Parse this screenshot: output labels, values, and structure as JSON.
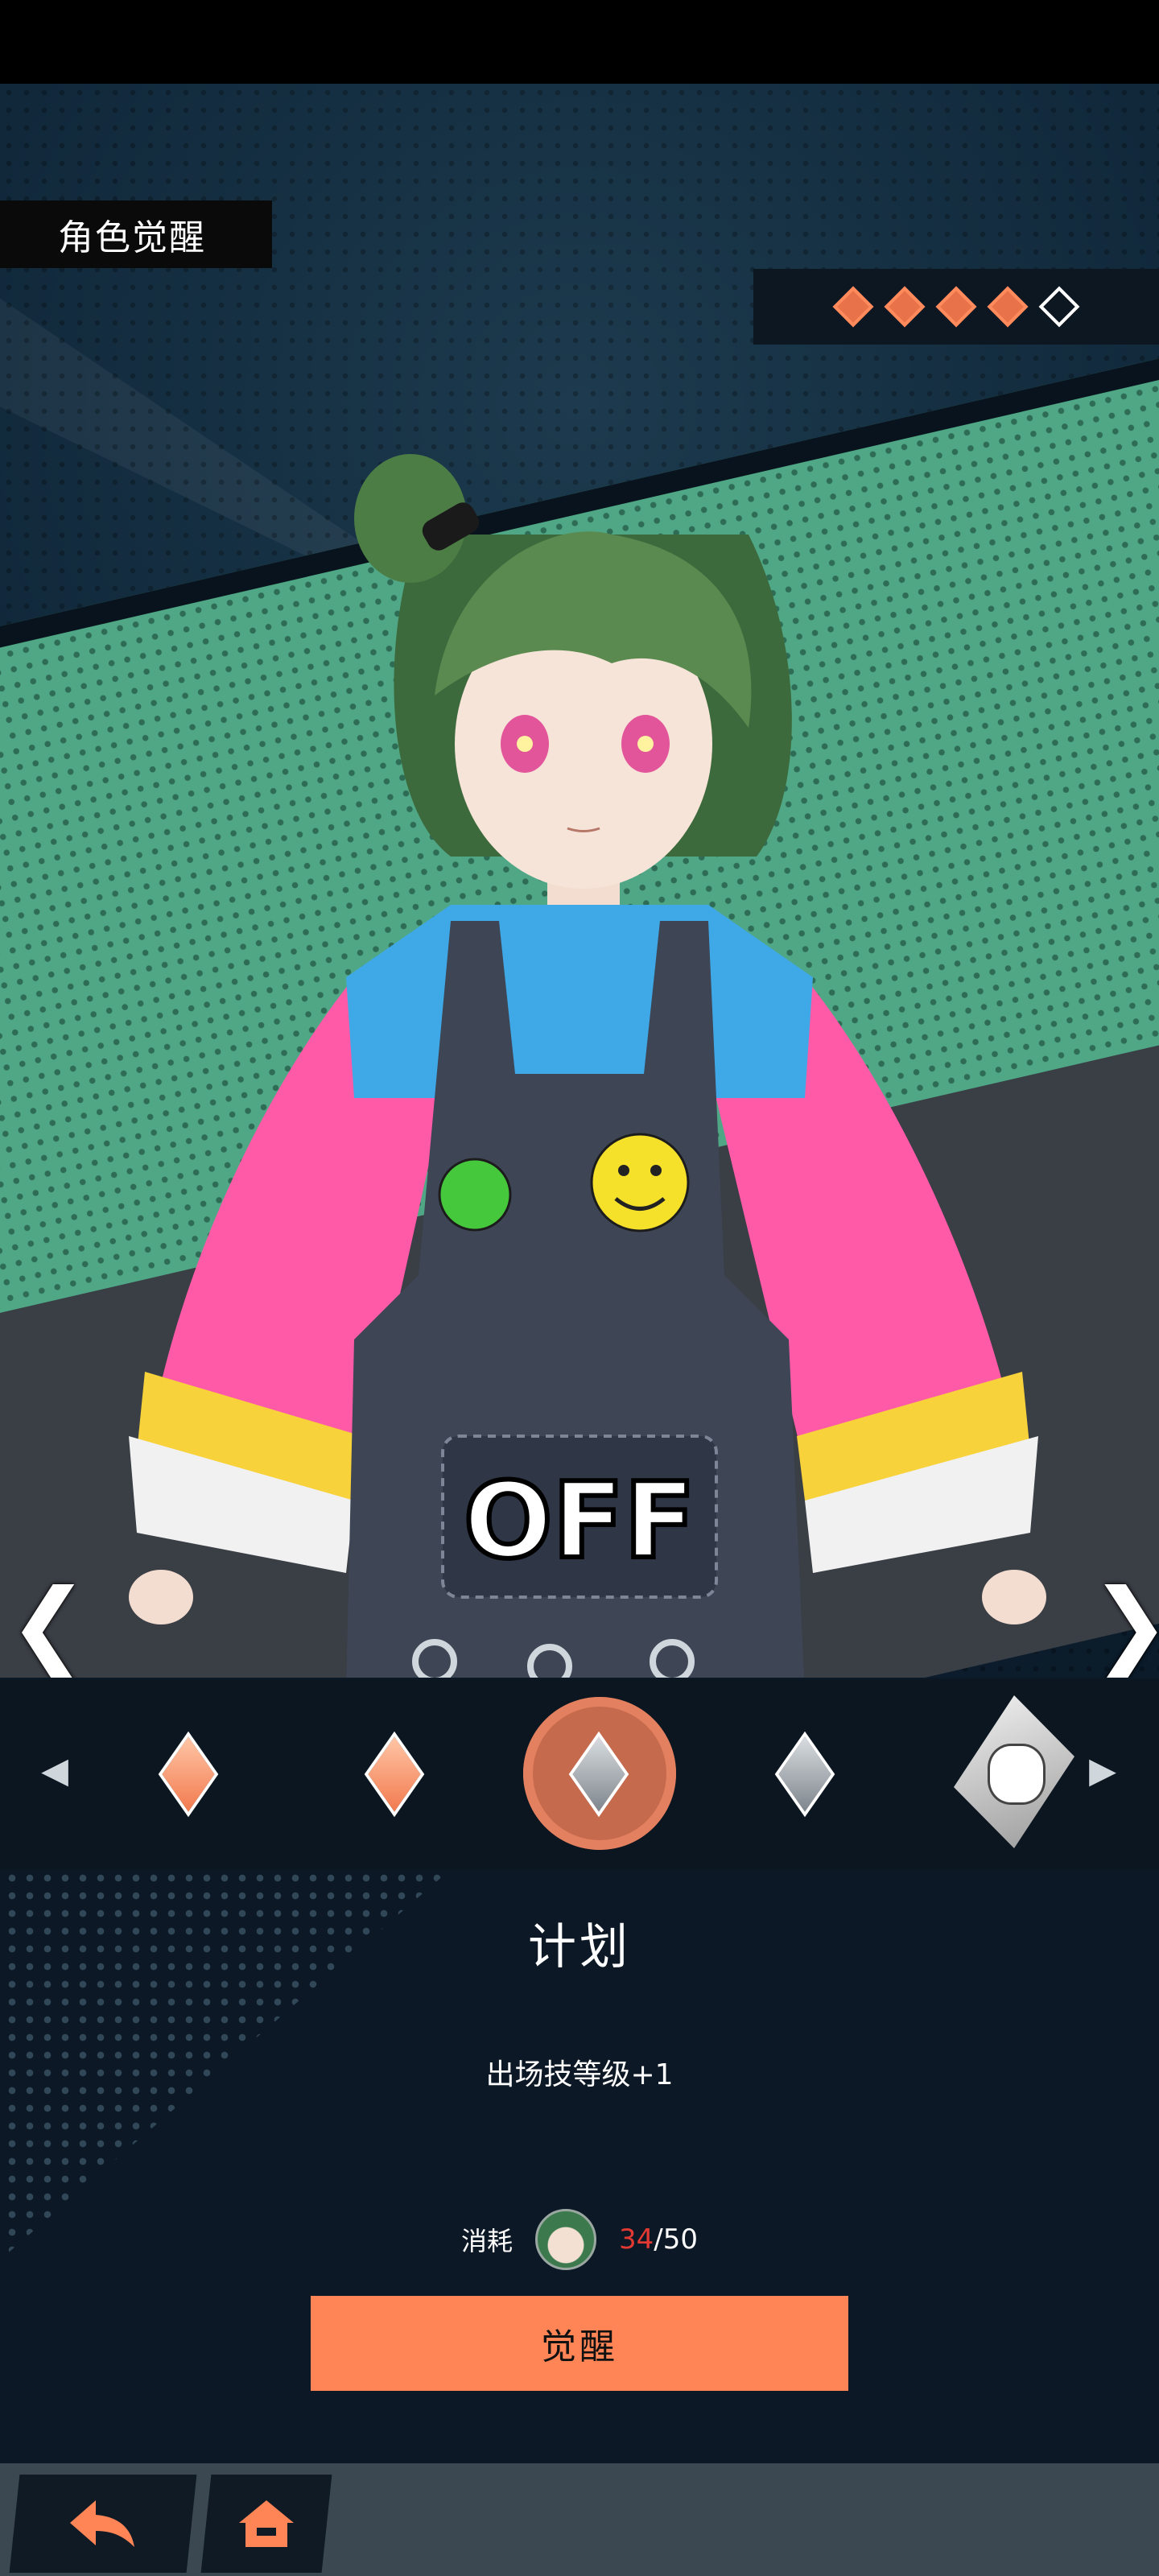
{
  "screen": {
    "title": "角色觉醒",
    "stars": {
      "filled": 4,
      "total": 5
    }
  },
  "navigation": {
    "prev_character": "❮",
    "next_character": "❯"
  },
  "awakening_strip": {
    "left_arrow": "◀",
    "right_arrow": "▶",
    "nodes": [
      {
        "type": "orange-gem"
      },
      {
        "type": "orange-gem"
      },
      {
        "type": "grey-gem",
        "selected": true
      },
      {
        "type": "grey-gem"
      },
      {
        "type": "portrait-gem"
      }
    ]
  },
  "skill": {
    "name": "计划",
    "description": "出场技等级+1"
  },
  "cost": {
    "label": "消耗",
    "have": "34",
    "separator": "/",
    "need": "50"
  },
  "actions": {
    "awaken_label": "觉醒"
  },
  "bottom_nav": {
    "back_icon": "back-arrow-icon",
    "home_icon": "home-icon"
  },
  "colors": {
    "accent": "#ff8456",
    "stage_green": "#4fa786",
    "cost_have": "#e23a32"
  }
}
